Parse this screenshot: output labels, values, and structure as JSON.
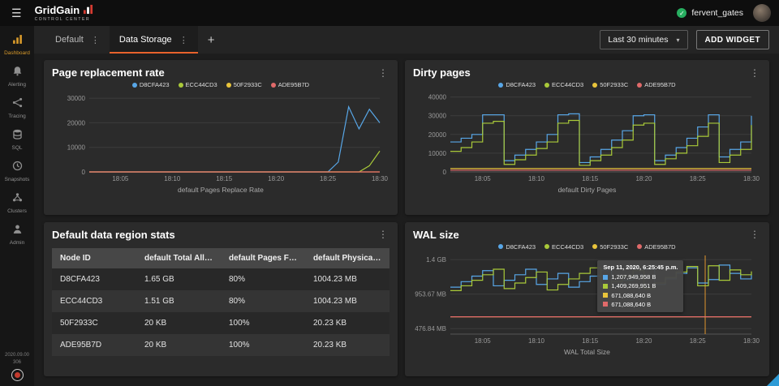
{
  "ui": {
    "kebab": "⋮",
    "caret": "▾",
    "hamburger": "☰",
    "check": "✓",
    "accent": "#e8622c"
  },
  "topbar": {
    "app_name": "GridGain",
    "app_subtitle": "CONTROL CENTER",
    "username": "fervent_gates"
  },
  "sidebar": {
    "items": [
      {
        "label": "Dashboard",
        "icon": "dashboard-icon",
        "active": true
      },
      {
        "label": "Alerting",
        "icon": "bell-icon",
        "active": false
      },
      {
        "label": "Tracing",
        "icon": "tracing-icon",
        "active": false
      },
      {
        "label": "SQL",
        "icon": "database-icon",
        "active": false
      },
      {
        "label": "Snapshots",
        "icon": "clock-icon",
        "active": false
      },
      {
        "label": "Clusters",
        "icon": "cluster-icon",
        "active": false
      },
      {
        "label": "Admin",
        "icon": "person-icon",
        "active": false
      }
    ],
    "version_line1": "2020.09.00",
    "version_line2": "306"
  },
  "tabbar": {
    "tabs": [
      {
        "label": "Default"
      },
      {
        "label": "Data Storage"
      }
    ],
    "add_tab_label": "+",
    "time_range_label": "Last 30 minutes",
    "add_widget_label": "ADD WIDGET"
  },
  "widgets": {
    "page_replacement": {
      "title": "Page replacement rate",
      "chart_data": {
        "type": "line",
        "title": "Page replacement rate",
        "xlabel": "default Pages Replace Rate",
        "ylabel": "",
        "xlim": [
          2,
          30
        ],
        "ylim": [
          0,
          32000
        ],
        "step": false,
        "legend_position": "top",
        "xticks": [
          {
            "value": 5,
            "label": "18:05"
          },
          {
            "value": 10,
            "label": "18:10"
          },
          {
            "value": 15,
            "label": "18:15"
          },
          {
            "value": 20,
            "label": "18:20"
          },
          {
            "value": 25,
            "label": "18:25"
          },
          {
            "value": 30,
            "label": "18:30"
          }
        ],
        "yticks": [
          {
            "value": 0,
            "label": "0"
          },
          {
            "value": 10000,
            "label": "10000"
          },
          {
            "value": 20000,
            "label": "20000"
          },
          {
            "value": 30000,
            "label": "30000"
          }
        ],
        "x": [
          2,
          3,
          4,
          5,
          6,
          7,
          8,
          9,
          10,
          11,
          12,
          13,
          14,
          15,
          16,
          17,
          18,
          19,
          20,
          21,
          22,
          23,
          24,
          25,
          26,
          27,
          28,
          29,
          30
        ],
        "series": [
          {
            "name": "D8CFA423",
            "color": "#58a7e8",
            "values": [
              0,
              0,
              0,
              0,
              0,
              0,
              0,
              0,
              0,
              0,
              0,
              0,
              0,
              0,
              0,
              0,
              0,
              0,
              0,
              0,
              0,
              0,
              0,
              0,
              4000,
              26500,
              17500,
              25500,
              20000
            ]
          },
          {
            "name": "ECC44CD3",
            "color": "#a9c939",
            "values": [
              0,
              0,
              0,
              0,
              0,
              0,
              0,
              0,
              0,
              0,
              0,
              0,
              0,
              0,
              0,
              0,
              0,
              0,
              0,
              0,
              0,
              0,
              0,
              0,
              0,
              0,
              0,
              2500,
              8500
            ]
          },
          {
            "name": "50F2933C",
            "color": "#e9c43b",
            "values": [
              0,
              0,
              0,
              0,
              0,
              0,
              0,
              0,
              0,
              0,
              0,
              0,
              0,
              0,
              0,
              0,
              0,
              0,
              0,
              0,
              0,
              0,
              0,
              0,
              0,
              0,
              0,
              0,
              0
            ]
          },
          {
            "name": "ADE95B7D",
            "color": "#e06a6a",
            "values": [
              0,
              0,
              0,
              0,
              0,
              0,
              0,
              0,
              0,
              0,
              0,
              0,
              0,
              0,
              0,
              0,
              0,
              0,
              0,
              0,
              0,
              0,
              0,
              0,
              0,
              0,
              0,
              0,
              0
            ]
          }
        ]
      }
    },
    "dirty_pages": {
      "title": "Dirty pages",
      "chart_data": {
        "type": "line",
        "title": "Dirty pages",
        "xlabel": "default Dirty Pages",
        "ylabel": "",
        "xlim": [
          2,
          30
        ],
        "ylim": [
          0,
          42000
        ],
        "step": true,
        "legend_position": "top",
        "xticks": [
          {
            "value": 5,
            "label": "18:05"
          },
          {
            "value": 10,
            "label": "18:10"
          },
          {
            "value": 15,
            "label": "18:15"
          },
          {
            "value": 20,
            "label": "18:20"
          },
          {
            "value": 25,
            "label": "18:25"
          },
          {
            "value": 30,
            "label": "18:30"
          }
        ],
        "yticks": [
          {
            "value": 0,
            "label": "0"
          },
          {
            "value": 10000,
            "label": "10000"
          },
          {
            "value": 20000,
            "label": "20000"
          },
          {
            "value": 30000,
            "label": "30000"
          },
          {
            "value": 40000,
            "label": "40000"
          }
        ],
        "x": [
          2,
          3,
          4,
          5,
          6,
          7,
          8,
          9,
          10,
          11,
          12,
          13,
          14,
          15,
          16,
          17,
          18,
          19,
          20,
          21,
          22,
          23,
          24,
          25,
          26,
          27,
          28,
          29,
          30
        ],
        "series": [
          {
            "name": "D8CFA423",
            "color": "#58a7e8",
            "values": [
              16000,
              18000,
              20000,
              30500,
              30500,
              6000,
              9000,
              12000,
              16000,
              20000,
              30500,
              31000,
              5000,
              8000,
              12000,
              17000,
              22000,
              30000,
              30500,
              6000,
              9000,
              13000,
              18000,
              24000,
              30500,
              8000,
              12000,
              16000,
              30000
            ]
          },
          {
            "name": "ECC44CD3",
            "color": "#a9c939",
            "values": [
              11000,
              13000,
              16000,
              26000,
              27000,
              4000,
              6500,
              9000,
              12500,
              16000,
              26000,
              27500,
              3500,
              6000,
              9000,
              13000,
              17000,
              25000,
              26000,
              4000,
              7000,
              10000,
              14000,
              19000,
              26000,
              5000,
              9000,
              12000,
              25000
            ]
          },
          {
            "name": "50F2933C",
            "color": "#e9c43b",
            "values": [
              1800,
              1800,
              1800,
              1800,
              1800,
              1800,
              1800,
              1800,
              1800,
              1800,
              1800,
              1800,
              1800,
              1800,
              1800,
              1800,
              1800,
              1800,
              1800,
              1800,
              1800,
              1800,
              1800,
              1800,
              1800,
              1800,
              1800,
              1800,
              1800
            ]
          },
          {
            "name": "ADE95B7D",
            "color": "#e06a6a",
            "values": [
              900,
              900,
              900,
              900,
              900,
              900,
              900,
              900,
              900,
              900,
              900,
              900,
              900,
              900,
              900,
              900,
              900,
              900,
              900,
              900,
              900,
              900,
              900,
              900,
              900,
              900,
              900,
              900,
              900
            ]
          }
        ]
      }
    },
    "region_stats": {
      "title": "Default data region stats",
      "table": {
        "columns": [
          "Node ID",
          "default Total Allocat...",
          "default Pages Fill F...",
          "default Physical Me..."
        ],
        "rows": [
          [
            "D8CFA423",
            "1.65 GB",
            "80%",
            "1004.23 MB"
          ],
          [
            "ECC44CD3",
            "1.51 GB",
            "80%",
            "1004.23 MB"
          ],
          [
            "50F2933C",
            "20 KB",
            "100%",
            "20.23 KB"
          ],
          [
            "ADE95B7D",
            "20 KB",
            "100%",
            "20.23 KB"
          ]
        ]
      }
    },
    "wal_size": {
      "title": "WAL size",
      "tooltip": {
        "title": "Sep 11, 2020, 6:25:45 p.m.",
        "rows": [
          {
            "color": "#58a7e8",
            "value": "1,207,949,958 B"
          },
          {
            "color": "#a9c939",
            "value": "1,409,269,951 B"
          },
          {
            "color": "#e9c43b",
            "value": "671,088,640 B"
          },
          {
            "color": "#e06a6a",
            "value": "671,088,640 B"
          }
        ]
      },
      "chart_data": {
        "type": "line",
        "title": "WAL size",
        "xlabel": "WAL Total Size",
        "ylabel": "",
        "y_unit": "bytes x 1e9",
        "xlim": [
          2,
          30
        ],
        "ylim": [
          0.42,
          1.56
        ],
        "step": true,
        "legend_position": "top",
        "cursor_x": 25.7,
        "cursor_color": "#e0962e",
        "xticks": [
          {
            "value": 5,
            "label": "18:05"
          },
          {
            "value": 10,
            "label": "18:10"
          },
          {
            "value": 15,
            "label": "18:15"
          },
          {
            "value": 20,
            "label": "18:20"
          },
          {
            "value": 25,
            "label": "18:25"
          },
          {
            "value": 30,
            "label": "18:30"
          }
        ],
        "yticks": [
          {
            "value": 0.5,
            "label": "476.84 MB"
          },
          {
            "value": 1.0,
            "label": "953.67 MB"
          },
          {
            "value": 1.5,
            "label": "1.4 GB"
          }
        ],
        "x": [
          2,
          3,
          4,
          5,
          6,
          7,
          8,
          9,
          10,
          11,
          12,
          13,
          14,
          15,
          16,
          17,
          18,
          19,
          20,
          21,
          22,
          23,
          24,
          25,
          26,
          27,
          28,
          29,
          30
        ],
        "series": [
          {
            "name": "D8CFA423",
            "color": "#58a7e8",
            "values": [
              1.1,
              1.18,
              1.26,
              1.34,
              1.12,
              1.2,
              1.28,
              1.36,
              1.14,
              1.22,
              1.3,
              1.1,
              1.18,
              1.26,
              1.34,
              1.12,
              1.2,
              1.28,
              1.36,
              1.14,
              1.22,
              1.3,
              1.38,
              1.16,
              1.21,
              1.42,
              1.3,
              1.22,
              1.28
            ]
          },
          {
            "name": "ECC44CD3",
            "color": "#a9c939",
            "values": [
              1.05,
              1.12,
              1.2,
              1.28,
              1.36,
              1.08,
              1.16,
              1.24,
              1.32,
              1.06,
              1.14,
              1.22,
              1.3,
              1.38,
              1.1,
              1.18,
              1.26,
              1.34,
              1.08,
              1.16,
              1.24,
              1.32,
              1.4,
              1.12,
              1.41,
              1.2,
              1.35,
              1.28,
              1.33
            ]
          },
          {
            "name": "50F2933C",
            "color": "#e9c43b",
            "values": [
              0.671,
              0.671,
              0.671,
              0.671,
              0.671,
              0.671,
              0.671,
              0.671,
              0.671,
              0.671,
              0.671,
              0.671,
              0.671,
              0.671,
              0.671,
              0.671,
              0.671,
              0.671,
              0.671,
              0.671,
              0.671,
              0.671,
              0.671,
              0.671,
              0.671,
              0.671,
              0.671,
              0.671,
              0.671
            ]
          },
          {
            "name": "ADE95B7D",
            "color": "#e06a6a",
            "values": [
              0.671,
              0.671,
              0.671,
              0.671,
              0.671,
              0.671,
              0.671,
              0.671,
              0.671,
              0.671,
              0.671,
              0.671,
              0.671,
              0.671,
              0.671,
              0.671,
              0.671,
              0.671,
              0.671,
              0.671,
              0.671,
              0.671,
              0.671,
              0.671,
              0.671,
              0.671,
              0.671,
              0.671,
              0.671
            ]
          }
        ]
      }
    }
  }
}
